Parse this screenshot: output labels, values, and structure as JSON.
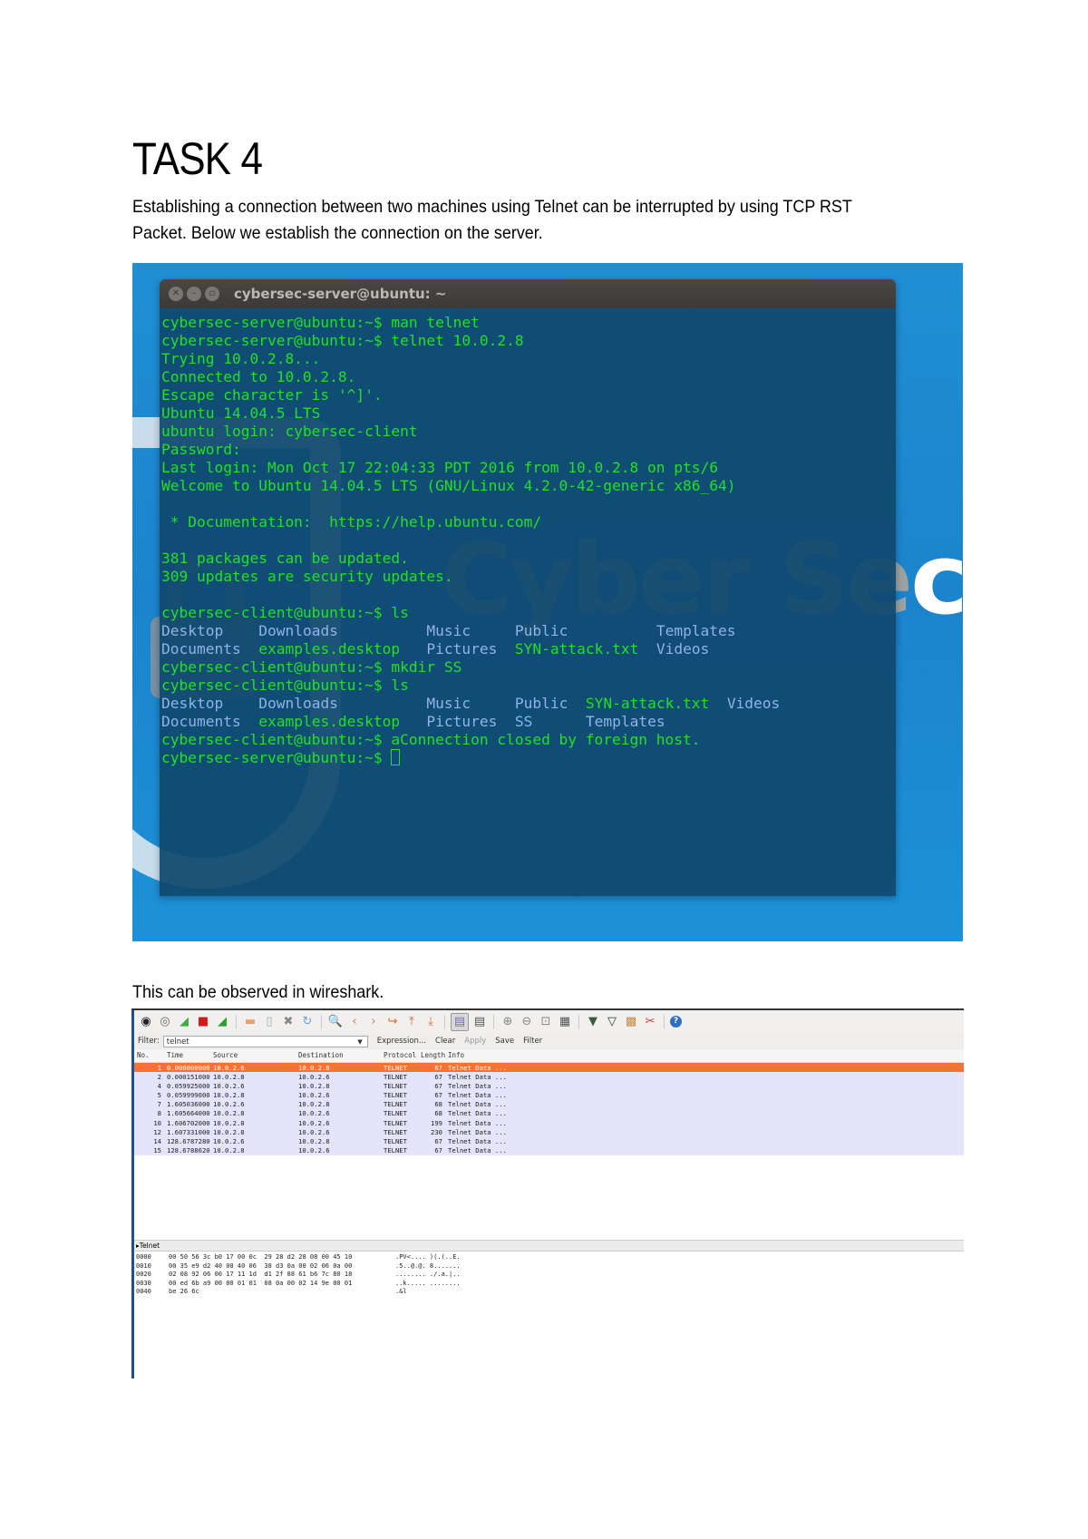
{
  "document": {
    "title": "TASK 4",
    "intro": [
      "Establishing a connection between two machines using Telnet can be interrupted by using TCP RST",
      "Packet. Below we establish the connection on the server."
    ],
    "wireshark_caption": "This can be observed in wireshark."
  },
  "terminal": {
    "window_title": "cybersec-server@ubuntu: ~",
    "window_buttons": [
      "close",
      "minimize",
      "maximize"
    ],
    "background_brand": "Cyber Sec",
    "lines": [
      {
        "text": "cybersec-server@ubuntu:~$ man telnet"
      },
      {
        "text": "cybersec-server@ubuntu:~$ telnet 10.0.2.8"
      },
      {
        "text": "Trying 10.0.2.8..."
      },
      {
        "text": "Connected to 10.0.2.8."
      },
      {
        "text": "Escape character is '^]'."
      },
      {
        "text": "Ubuntu 14.04.5 LTS"
      },
      {
        "text": "ubuntu login: cybersec-client"
      },
      {
        "text": "Password:"
      },
      {
        "text": "Last login: Mon Oct 17 22:04:33 PDT 2016 from 10.0.2.8 on pts/6"
      },
      {
        "text": "Welcome to Ubuntu 14.04.5 LTS (GNU/Linux 4.2.0-42-generic x86_64)"
      },
      {
        "text": ""
      },
      {
        "text": " * Documentation:  https://help.ubuntu.com/"
      },
      {
        "text": ""
      },
      {
        "text": "381 packages can be updated."
      },
      {
        "text": "309 updates are security updates."
      },
      {
        "text": ""
      },
      {
        "text": "cybersec-client@ubuntu:~$ ls"
      }
    ],
    "ls1": [
      [
        "Desktop",
        "Downloads",
        "Music",
        "Public",
        "Templates"
      ],
      [
        "Documents",
        "examples.desktop",
        "Pictures",
        "SYN-attack.txt",
        "Videos"
      ]
    ],
    "mkdir_line": "cybersec-client@ubuntu:~$ mkdir SS",
    "ls_line": "cybersec-client@ubuntu:~$ ls",
    "ls2": [
      [
        "Desktop",
        "Downloads",
        "Music",
        "Public",
        "SYN-attack.txt",
        "Videos"
      ],
      [
        "Documents",
        "examples.desktop",
        "Pictures",
        "SS",
        "Templates"
      ]
    ],
    "closed_line": "cybersec-client@ubuntu:~$ aConnection closed by foreign host.",
    "final_prompt": "cybersec-server@ubuntu:~$ "
  },
  "wireshark": {
    "toolbar_icons": [
      "interface-list-icon",
      "capture-options-icon",
      "start-capture-icon",
      "stop-capture-icon",
      "restart-capture-icon",
      "open-file-icon",
      "save-file-icon",
      "close-file-icon",
      "reload-icon",
      "find-packet-icon",
      "go-back-icon",
      "go-forward-icon",
      "go-to-packet-icon",
      "go-first-icon",
      "go-last-icon",
      "colorize-icon",
      "autoscroll-icon",
      "zoom-in-icon",
      "zoom-out-icon",
      "normal-size-icon",
      "resize-columns-icon",
      "capture-filters-icon",
      "display-filters-icon",
      "coloring-rules-icon",
      "preferences-icon",
      "help-icon"
    ],
    "filter": {
      "label": "Filter:",
      "value": "telnet",
      "buttons": [
        "Expression...",
        "Clear",
        "Apply",
        "Save",
        "Filter"
      ]
    },
    "columns": [
      "No.",
      "Time",
      "Source",
      "Destination",
      "Protocol",
      "Length",
      "Info"
    ],
    "packets": [
      {
        "no": "1",
        "time": "0.000000000",
        "src": "10.0.2.6",
        "dst": "10.0.2.8",
        "proto": "TELNET",
        "len": "67",
        "info": "Telnet Data ...",
        "selected": true
      },
      {
        "no": "2",
        "time": "0.000151000",
        "src": "10.0.2.8",
        "dst": "10.0.2.6",
        "proto": "TELNET",
        "len": "67",
        "info": "Telnet Data ..."
      },
      {
        "no": "4",
        "time": "0.059925000",
        "src": "10.0.2.6",
        "dst": "10.0.2.8",
        "proto": "TELNET",
        "len": "67",
        "info": "Telnet Data ..."
      },
      {
        "no": "5",
        "time": "0.059999000",
        "src": "10.0.2.8",
        "dst": "10.0.2.6",
        "proto": "TELNET",
        "len": "67",
        "info": "Telnet Data ..."
      },
      {
        "no": "7",
        "time": "1.605036000",
        "src": "10.0.2.6",
        "dst": "10.0.2.8",
        "proto": "TELNET",
        "len": "68",
        "info": "Telnet Data ..."
      },
      {
        "no": "8",
        "time": "1.605664000",
        "src": "10.0.2.8",
        "dst": "10.0.2.6",
        "proto": "TELNET",
        "len": "68",
        "info": "Telnet Data ..."
      },
      {
        "no": "10",
        "time": "1.606702000",
        "src": "10.0.2.8",
        "dst": "10.0.2.6",
        "proto": "TELNET",
        "len": "199",
        "info": "Telnet Data ..."
      },
      {
        "no": "12",
        "time": "1.607331000",
        "src": "10.0.2.8",
        "dst": "10.0.2.6",
        "proto": "TELNET",
        "len": "230",
        "info": "Telnet Data ..."
      },
      {
        "no": "14",
        "time": "128.6787280",
        "src": "10.0.2.6",
        "dst": "10.0.2.8",
        "proto": "TELNET",
        "len": "67",
        "info": "Telnet Data ..."
      },
      {
        "no": "15",
        "time": "128.6788620",
        "src": "10.0.2.8",
        "dst": "10.0.2.6",
        "proto": "TELNET",
        "len": "67",
        "info": "Telnet Data ..."
      }
    ],
    "detail_tree": "▸Telnet",
    "hex_dump": [
      {
        "offset": "0000",
        "bytes": "00 50 56 3c b0 17 00 0c  29 28 d2 28 08 00 45 10",
        "ascii": ".PV<.... )(.(..E."
      },
      {
        "offset": "0010",
        "bytes": "00 35 e9 d2 40 00 40 06  38 d3 0a 00 02 06 0a 00",
        "ascii": ".5..@.@. 8......."
      },
      {
        "offset": "0020",
        "bytes": "02 08 92 06 00 17 11 1d  d1 2f 88 61 b6 7c 80 18",
        "ascii": "........ ./.a.|.."
      },
      {
        "offset": "0030",
        "bytes": "00 ed 6b a9 00 00 01 01  08 0a 00 02 14 9e 00 01",
        "ascii": "..k..... ........"
      },
      {
        "offset": "0040",
        "bytes": "be 26 6c",
        "ascii": ".&l"
      }
    ]
  }
}
